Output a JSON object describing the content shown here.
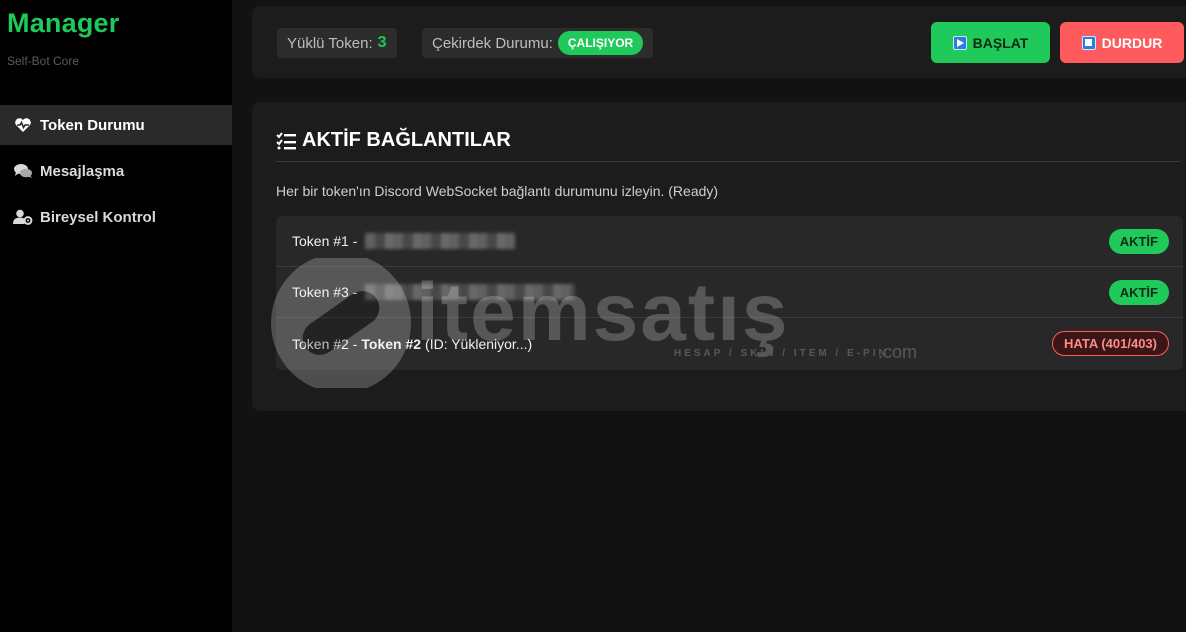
{
  "brand": {
    "title": "Manager",
    "subtitle": "Self-Bot Core"
  },
  "sidebar": {
    "items": [
      {
        "label": "Token Durumu",
        "icon": "heartbeat-icon",
        "active": true
      },
      {
        "label": "Mesajlaşma",
        "icon": "chat-bubbles-icon",
        "active": false
      },
      {
        "label": "Bireysel Kontrol",
        "icon": "user-cog-icon",
        "active": false
      }
    ]
  },
  "topbar": {
    "loaded_token_label": "Yüklü Token:",
    "loaded_token_value": "3",
    "core_status_label": "Çekirdek Durumu:",
    "core_status_value": "ÇALIŞIYOR",
    "start_label": "BAŞLAT",
    "stop_label": "DURDUR"
  },
  "panel": {
    "title": "AKTİF BAĞLANTILAR",
    "description": "Her bir token'ın Discord WebSocket bağlantı durumunu izleyin. (Ready)",
    "rows": [
      {
        "prefix": "Token #1 -",
        "name": "",
        "detail": "",
        "status": "AKTİF",
        "status_type": "ok"
      },
      {
        "prefix": "Token #3 -",
        "name": "",
        "detail": "",
        "status": "AKTİF",
        "status_type": "ok"
      },
      {
        "prefix": "Token #2 -",
        "name": "Token #2",
        "detail": "(ID: Yükleniyor...)",
        "status": "HATA (401/403)",
        "status_type": "error"
      }
    ]
  },
  "watermark": {
    "text": "itemsatış",
    "tagline": "HESAP / SKIN / ITEM / E-PIN",
    "suffix": ".com"
  },
  "colors": {
    "accent_green": "#1fc95a",
    "danger_red": "#ff5b5e",
    "sidebar_bg": "#000000",
    "main_bg": "#121212"
  }
}
